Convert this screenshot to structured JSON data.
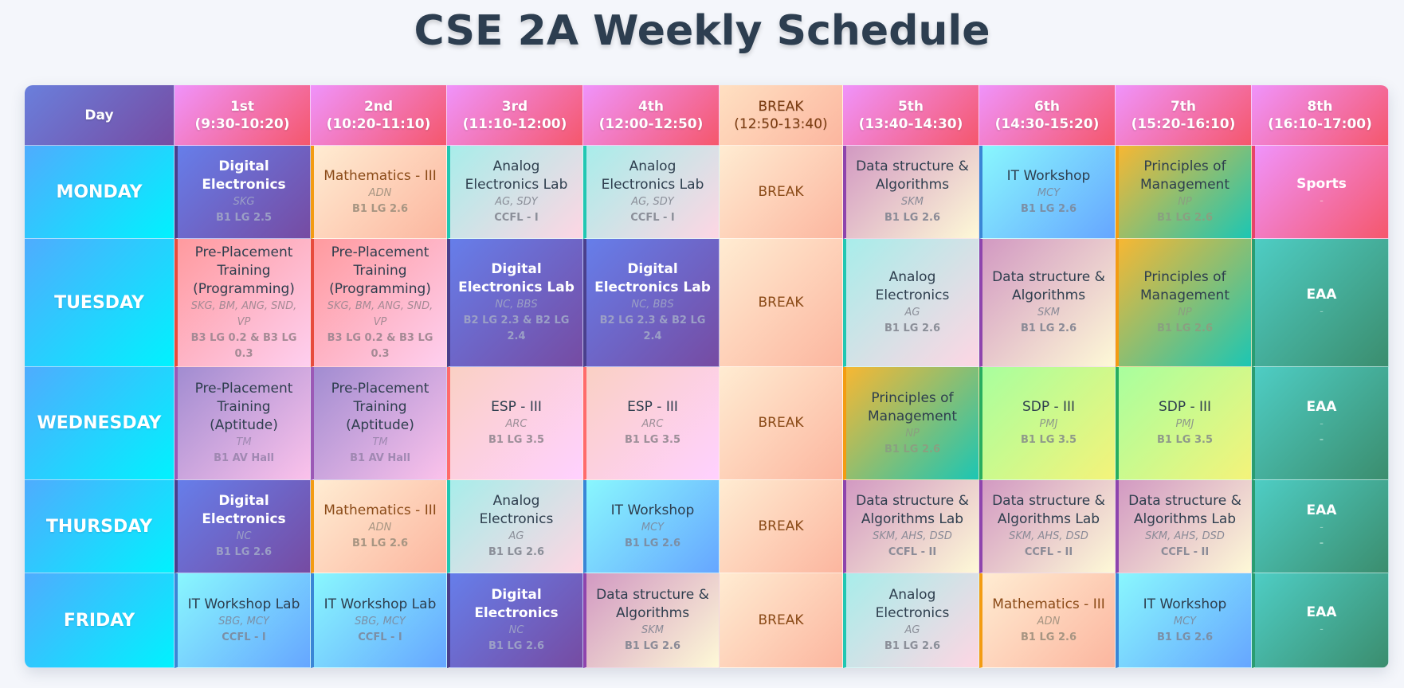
{
  "title": "CSE 2A Weekly Schedule",
  "headers": {
    "day": "Day",
    "p1": [
      "1st",
      "(9:30-10:20)"
    ],
    "p2": [
      "2nd",
      "(10:20-11:10)"
    ],
    "p3": [
      "3rd",
      "(11:10-12:00)"
    ],
    "p4": [
      "4th",
      "(12:00-12:50)"
    ],
    "brk": [
      "BREAK",
      "(12:50-13:40)"
    ],
    "p5": [
      "5th",
      "(13:40-14:30)"
    ],
    "p6": [
      "6th",
      "(14:30-15:20)"
    ],
    "p7": [
      "7th",
      "(15:20-16:10)"
    ],
    "p8": [
      "8th",
      "(16:10-17:00)"
    ]
  },
  "days": {
    "mon": {
      "label": "MONDAY",
      "p1": {
        "subject": "Digital Electronics",
        "faculty": "SKG",
        "room": "B1 LG 2.5"
      },
      "p2": {
        "subject": "Mathematics - III",
        "faculty": "ADN",
        "room": "B1 LG 2.6"
      },
      "p3": {
        "subject": "Analog Electronics Lab",
        "faculty": "AG, SDY",
        "room": "CCFL - I"
      },
      "p4": {
        "subject": "Analog Electronics Lab",
        "faculty": "AG, SDY",
        "room": "CCFL - I"
      },
      "brk": {
        "subject": "BREAK"
      },
      "p5": {
        "subject": "Data structure & Algorithms",
        "faculty": "SKM",
        "room": "B1 LG 2.6"
      },
      "p6": {
        "subject": "IT Workshop",
        "faculty": "MCY",
        "room": "B1 LG 2.6"
      },
      "p7": {
        "subject": "Principles of Management",
        "faculty": "NP",
        "room": "B1 LG 2.6"
      },
      "p8": {
        "subject": "Sports",
        "faculty": "-",
        "room": ""
      }
    },
    "tue": {
      "label": "TUESDAY",
      "p1": {
        "subject": "Pre-Placement Training (Programming)",
        "faculty": "SKG, BM, ANG, SND, VP",
        "room": "B3 LG 0.2 & B3 LG 0.3"
      },
      "p2": {
        "subject": "Pre-Placement Training (Programming)",
        "faculty": "SKG, BM, ANG, SND, VP",
        "room": "B3 LG 0.2 & B3 LG 0.3"
      },
      "p3": {
        "subject": "Digital Electronics Lab",
        "faculty": "NC, BBS",
        "room": "B2 LG 2.3 & B2 LG 2.4"
      },
      "p4": {
        "subject": "Digital Electronics Lab",
        "faculty": "NC, BBS",
        "room": "B2 LG 2.3 & B2 LG 2.4"
      },
      "brk": {
        "subject": "BREAK"
      },
      "p5": {
        "subject": "Analog Electronics",
        "faculty": "AG",
        "room": "B1 LG 2.6"
      },
      "p6": {
        "subject": "Data structure & Algorithms",
        "faculty": "SKM",
        "room": "B1 LG 2.6"
      },
      "p7": {
        "subject": "Principles of Management",
        "faculty": "NP",
        "room": "B1 LG 2.6"
      },
      "p8": {
        "subject": "EAA",
        "faculty": "-",
        "room": ""
      }
    },
    "wed": {
      "label": "WEDNESDAY",
      "p1": {
        "subject": "Pre-Placement Training (Aptitude)",
        "faculty": "TM",
        "room": "B1 AV Hall"
      },
      "p2": {
        "subject": "Pre-Placement Training (Aptitude)",
        "faculty": "TM",
        "room": "B1 AV Hall"
      },
      "p3": {
        "subject": "ESP - III",
        "faculty": "ARC",
        "room": "B1 LG 3.5"
      },
      "p4": {
        "subject": "ESP - III",
        "faculty": "ARC",
        "room": "B1 LG 3.5"
      },
      "brk": {
        "subject": "BREAK"
      },
      "p5": {
        "subject": "Principles of Management",
        "faculty": "NP",
        "room": "B1 LG 2.6"
      },
      "p6": {
        "subject": "SDP - III",
        "faculty": "PMJ",
        "room": "B1 LG 3.5"
      },
      "p7": {
        "subject": "SDP - III",
        "faculty": "PMJ",
        "room": "B1 LG 3.5"
      },
      "p8": {
        "subject": "EAA",
        "faculty": "-",
        "room": "-"
      }
    },
    "thu": {
      "label": "THURSDAY",
      "p1": {
        "subject": "Digital Electronics",
        "faculty": "NC",
        "room": "B1 LG 2.6"
      },
      "p2": {
        "subject": "Mathematics - III",
        "faculty": "ADN",
        "room": "B1 LG 2.6"
      },
      "p3": {
        "subject": "Analog Electronics",
        "faculty": "AG",
        "room": "B1 LG 2.6"
      },
      "p4": {
        "subject": "IT Workshop",
        "faculty": "MCY",
        "room": "B1 LG 2.6"
      },
      "brk": {
        "subject": "BREAK"
      },
      "p5": {
        "subject": "Data structure & Algorithms Lab",
        "faculty": "SKM, AHS, DSD",
        "room": "CCFL - II"
      },
      "p6": {
        "subject": "Data structure & Algorithms Lab",
        "faculty": "SKM, AHS, DSD",
        "room": "CCFL - II"
      },
      "p7": {
        "subject": "Data structure & Algorithms Lab",
        "faculty": "SKM, AHS, DSD",
        "room": "CCFL - II"
      },
      "p8": {
        "subject": "EAA",
        "faculty": "-",
        "room": "-"
      }
    },
    "fri": {
      "label": "FRIDAY",
      "p1": {
        "subject": "IT Workshop Lab",
        "faculty": "SBG, MCY",
        "room": "CCFL - I"
      },
      "p2": {
        "subject": "IT Workshop Lab",
        "faculty": "SBG, MCY",
        "room": "CCFL - I"
      },
      "p3": {
        "subject": "Digital Electronics",
        "faculty": "NC",
        "room": "B1 LG 2.6"
      },
      "p4": {
        "subject": "Data structure & Algorithms",
        "faculty": "SKM",
        "room": "B1 LG 2.6"
      },
      "brk": {
        "subject": "BREAK"
      },
      "p5": {
        "subject": "Analog Electronics",
        "faculty": "AG",
        "room": "B1 LG 2.6"
      },
      "p6": {
        "subject": "Mathematics - III",
        "faculty": "ADN",
        "room": "B1 LG 2.6"
      },
      "p7": {
        "subject": "IT Workshop",
        "faculty": "MCY",
        "room": "B1 LG 2.6"
      },
      "p8": {
        "subject": "EAA",
        "faculty": "-",
        "room": ""
      }
    }
  }
}
